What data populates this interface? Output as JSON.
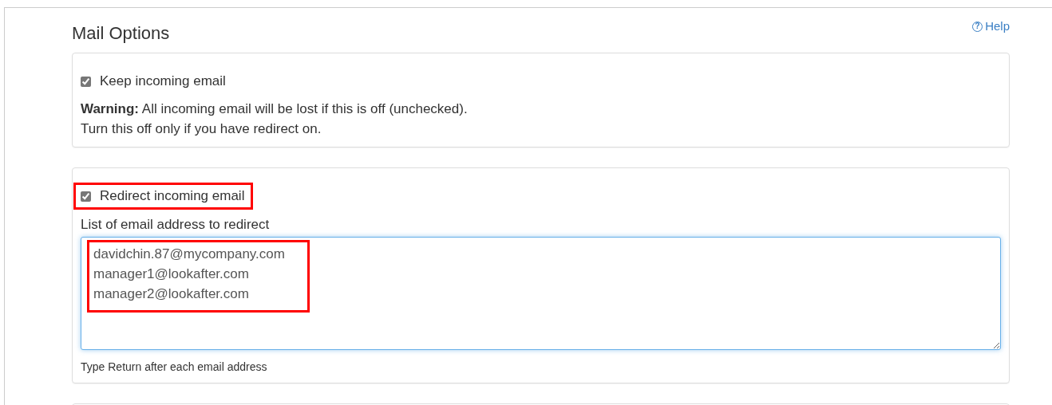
{
  "title": "Mail Options",
  "help_link": {
    "icon": "?",
    "label": "Help"
  },
  "keep_panel": {
    "checkbox": {
      "label": "Keep incoming email",
      "checked": true,
      "highlighted": false
    },
    "warning": "**Warning:** All incoming email will be lost if this is off (unchecked).",
    "note": "Turn this off only if you have redirect on."
  },
  "redirect_panel": {
    "checkbox": {
      "label": "Redirect incoming email",
      "checked": true,
      "highlighted": true
    },
    "field_label": "List of email address to redirect",
    "addresses": {
      "value": "davidchin.87@mycompany.com\nmanager1@lookafter.com\nmanager2@lookafter.com",
      "focused": true,
      "highlighted": true
    },
    "hint": "Type Return after each email address"
  }
}
